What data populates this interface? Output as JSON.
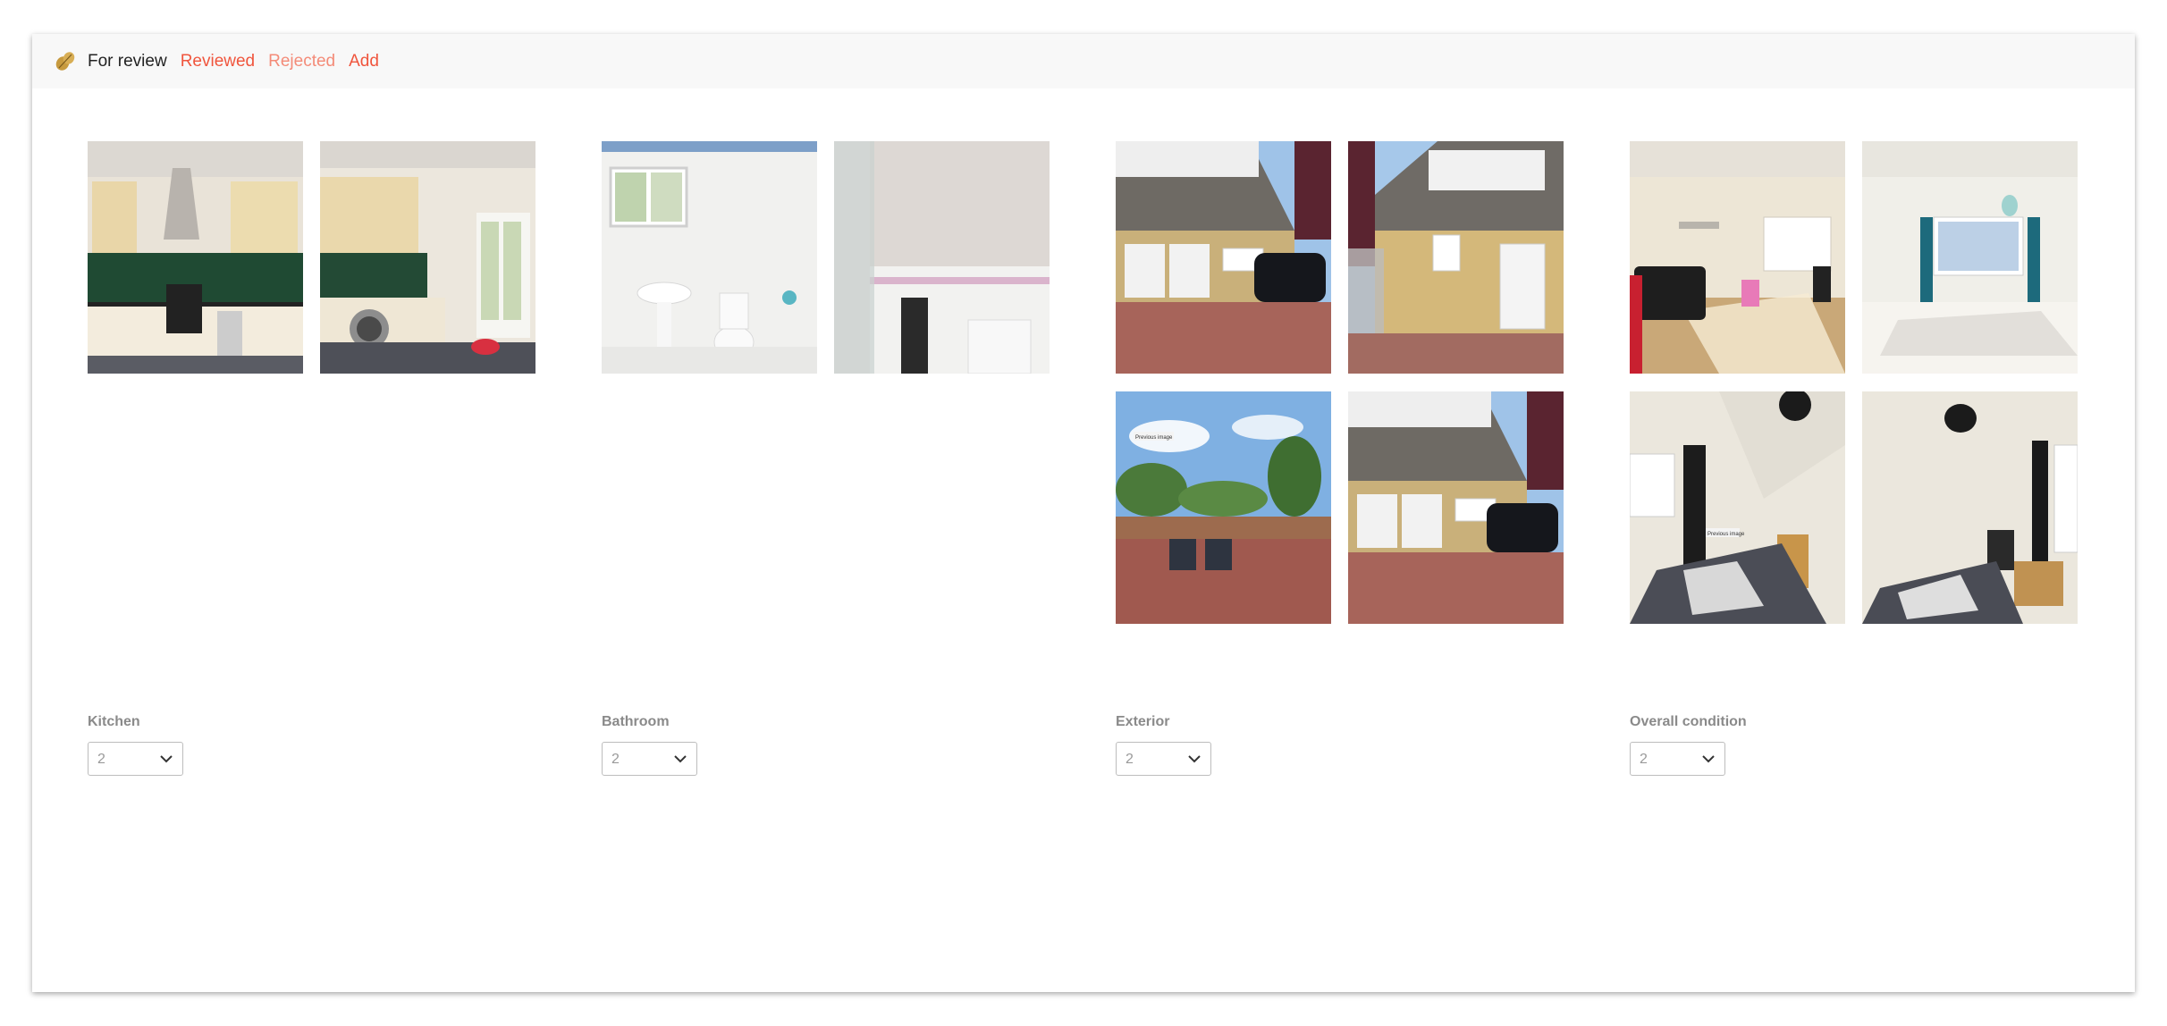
{
  "nav": {
    "logo_icon": "peanut-logo-icon",
    "items": [
      {
        "label": "For review",
        "active": true
      },
      {
        "label": "Reviewed",
        "active": false
      },
      {
        "label": "Rejected",
        "active": false
      },
      {
        "label": "Add",
        "active": false
      }
    ]
  },
  "colors": {
    "accent": "#f0553d",
    "navbar_bg": "#f8f8f8",
    "label": "#8a8a8a"
  },
  "groups": [
    {
      "label": "Kitchen",
      "rating": "2",
      "photos": [
        "kitchen-photo",
        "kitchen-photo"
      ]
    },
    {
      "label": "Bathroom",
      "rating": "2",
      "photos": [
        "bathroom-photo",
        "bathroom-photo"
      ]
    },
    {
      "label": "Exterior",
      "rating": "2",
      "photos": [
        "house-front-photo",
        "house-rear-photo",
        "garden-photo",
        "house-front-photo"
      ],
      "photo_captions": [
        "",
        "",
        "Previous image",
        ""
      ]
    },
    {
      "label": "Overall condition",
      "rating": "2",
      "photos": [
        "living-room-photo",
        "bedroom-photo",
        "bedroom-photo",
        "bedroom-photo"
      ],
      "photo_captions": [
        "",
        "",
        "Previous image",
        ""
      ]
    }
  ]
}
